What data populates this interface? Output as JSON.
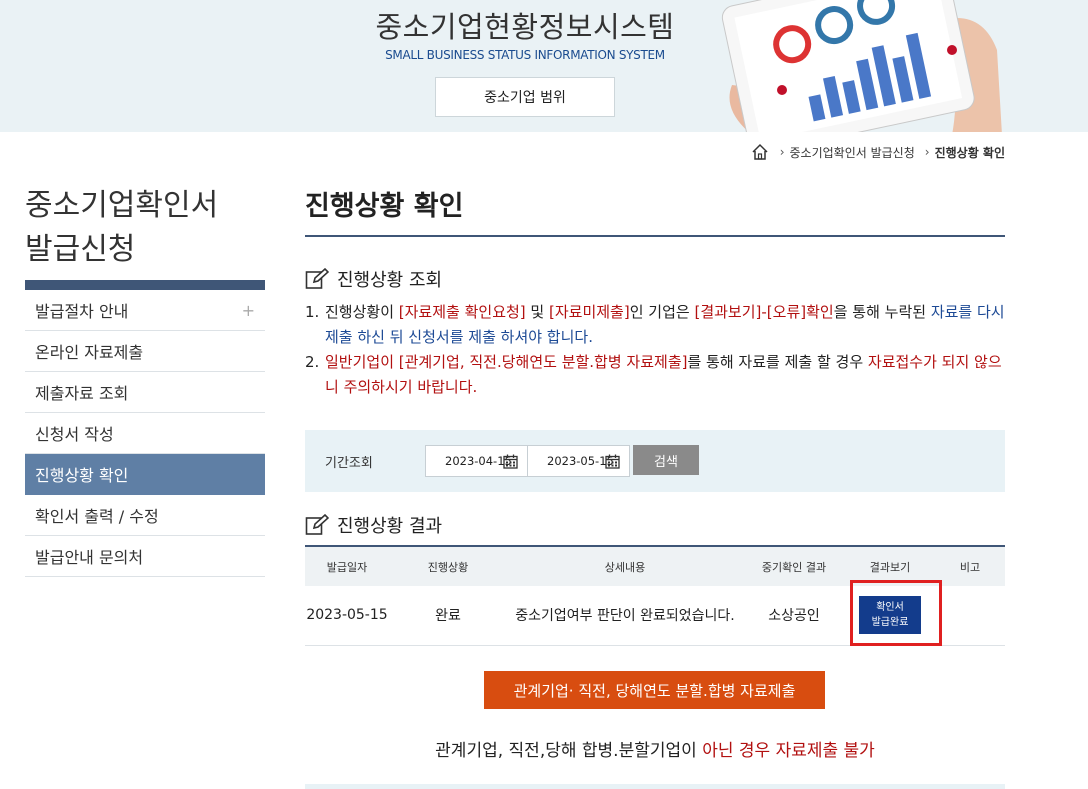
{
  "header": {
    "title": "중소기업현황정보시스템",
    "subtitle": "SMALL BUSINESS STATUS INFORMATION SYSTEM",
    "scope_button": "중소기업 범위"
  },
  "breadcrumb": {
    "items": [
      "중소기업확인서 발급신청",
      "진행상황 확인"
    ]
  },
  "sidebar": {
    "title_line1": "중소기업확인서",
    "title_line2": "발급신청",
    "items": [
      {
        "label": "발급절차 안내",
        "plus": "+"
      },
      {
        "label": "온라인 자료제출"
      },
      {
        "label": "제출자료 조회"
      },
      {
        "label": "신청서 작성"
      },
      {
        "label": "진행상황 확인"
      },
      {
        "label": "확인서 출력 / 수정"
      },
      {
        "label": "발급안내 문의처"
      }
    ]
  },
  "main": {
    "page_title": "진행상황 확인",
    "inquiry_heading": "진행상황 조회",
    "notice1": {
      "num": "1.",
      "p1": "진행상황이 ",
      "p2": "[자료제출 확인요청]",
      "p3": " 및 ",
      "p4": "[자료미제출]",
      "p5": "인 기업은 ",
      "p6": "[결과보기]-[오류]확인",
      "p7": "을 통해 누락된 ",
      "p8": "자료를 다시 제출 하신 뒤 신청서를 제출 하셔야 합니다."
    },
    "notice2": {
      "num": "2.",
      "p1": "일반기업이 [관계기업, 직전.당해연도 분할.합병 자료제출]",
      "p2": "를 통해 자료를 제출 할 경우 ",
      "p3": "자료접수가 되지 않으니 주의하시기 바랍니다."
    },
    "search": {
      "label": "기간조회",
      "start_date": "2023-04-15",
      "end_date": "2023-05-15",
      "button": "검색"
    },
    "result_heading": "진행상황 결과",
    "table": {
      "headers": [
        "발급일자",
        "진행상황",
        "상세내용",
        "중기확인 결과",
        "결과보기",
        "비고"
      ],
      "row": {
        "date": "2023-05-15",
        "status": "완료",
        "detail": "중소기업여부 판단이 완료되었습니다.",
        "result": "소상공인",
        "view_line1": "확인서",
        "view_line2": "발급완료",
        "note": ""
      }
    },
    "submit_button": "관계기업· 직전, 당해연도 분할.합병 자료제출",
    "bottom_note_p1": "관계기업, 직전,당해 합병.분할기업이 ",
    "bottom_note_p2": "아닌 경우 자료제출 불가"
  },
  "colors": {
    "navy": "#3f5677",
    "sidebar_active": "#5f7fa5",
    "accent_red": "#b21010",
    "accent_blue": "#1d4a95",
    "orange_button": "#d84d10",
    "cert_button": "#133c8c",
    "highlight": "#e02020"
  }
}
